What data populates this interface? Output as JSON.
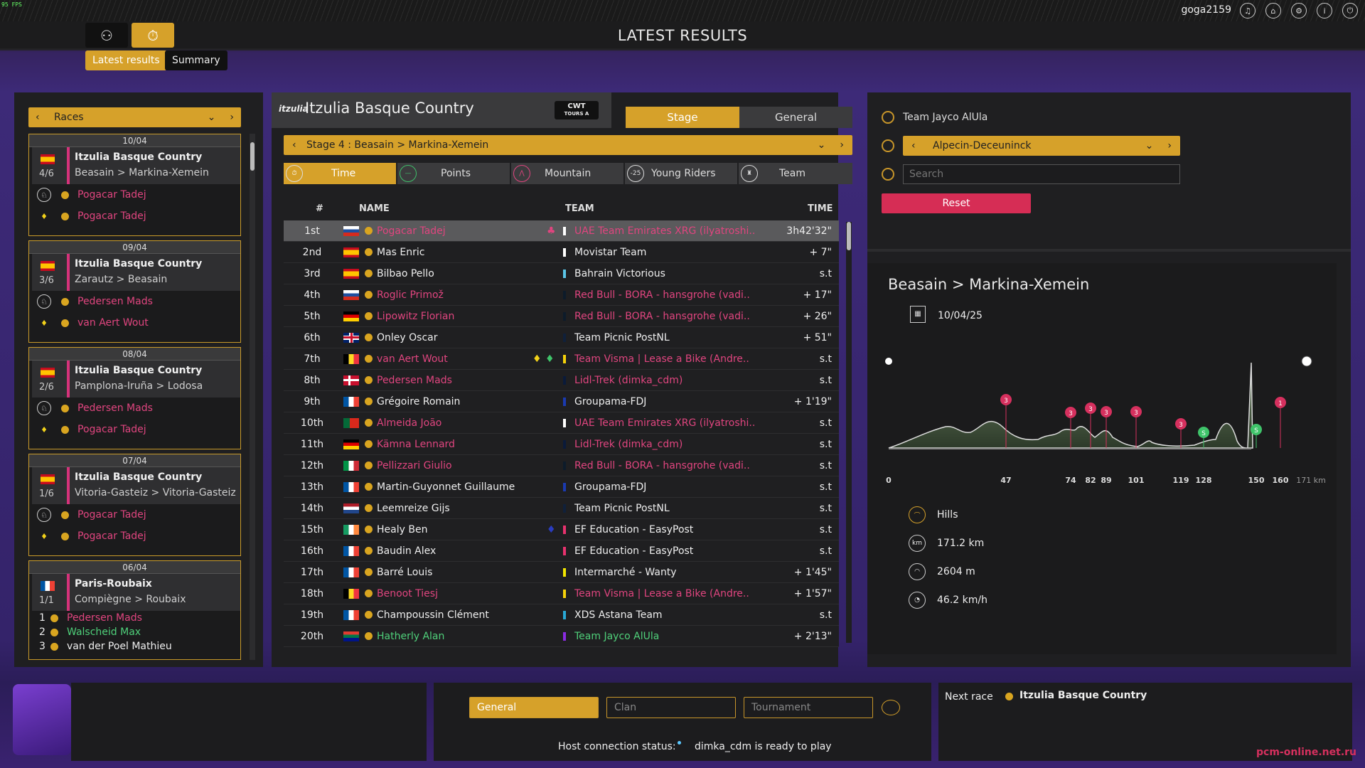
{
  "fps": "95 FPS",
  "user": "goga2159",
  "page_title": "LATEST RESULTS",
  "subtabs": [
    "Latest results",
    "Summary"
  ],
  "races_dropdown": "Races",
  "race_cards": [
    {
      "date": "10/04",
      "name": "Itzulia Basque Country",
      "stage": "4/6",
      "route": "Beasain > Markina-Xemein",
      "flag": "es",
      "lines": [
        {
          "icon": "stage-winner-icon",
          "rider": "Pogacar Tadej"
        },
        {
          "icon": "yellow-jersey-icon",
          "rider": "Pogacar Tadej"
        }
      ]
    },
    {
      "date": "09/04",
      "name": "Itzulia Basque Country",
      "stage": "3/6",
      "route": "Zarautz > Beasain",
      "flag": "es",
      "lines": [
        {
          "icon": "stage-winner-icon",
          "rider": "Pedersen Mads"
        },
        {
          "icon": "yellow-jersey-icon",
          "rider": "van Aert Wout"
        }
      ]
    },
    {
      "date": "08/04",
      "name": "Itzulia Basque Country",
      "stage": "2/6",
      "route": "Pamplona-Iruña > Lodosa",
      "flag": "es",
      "lines": [
        {
          "icon": "stage-winner-icon",
          "rider": "Pedersen Mads"
        },
        {
          "icon": "yellow-jersey-icon",
          "rider": "Pogacar Tadej"
        }
      ]
    },
    {
      "date": "07/04",
      "name": "Itzulia Basque Country",
      "stage": "1/6",
      "route": "Vitoria-Gasteiz > Vitoria-Gasteiz",
      "flag": "es",
      "lines": [
        {
          "icon": "stage-winner-icon",
          "rider": "Pogacar Tadej"
        },
        {
          "icon": "yellow-jersey-icon",
          "rider": "Pogacar Tadej"
        }
      ]
    },
    {
      "date": "06/04",
      "name": "Paris-Roubaix",
      "stage": "1/1",
      "route": "Compiègne > Roubaix",
      "flag": "fr",
      "podium": [
        {
          "pos": "1",
          "rider": "Pedersen Mads",
          "color": "pink"
        },
        {
          "pos": "2",
          "rider": "Walscheid Max",
          "color": "green"
        },
        {
          "pos": "3",
          "rider": "van der Poel Mathieu",
          "color": "white"
        }
      ]
    }
  ],
  "race": {
    "name": "Itzulia Basque Country",
    "logo_text": "itzulia",
    "badge_line1": "CWT",
    "badge_line2": "TOURS A"
  },
  "view_tabs": [
    "Stage",
    "General"
  ],
  "stage_select": "Stage 4 : Beasain > Markina-Xemein",
  "classification_tabs": [
    "Time",
    "Points",
    "Mountain",
    "Young Riders",
    "Team"
  ],
  "young_riders_badge": "-25",
  "table_headers": {
    "pos": "#",
    "name": "NAME",
    "team": "TEAM",
    "time": "TIME"
  },
  "results": [
    {
      "pos": "1st",
      "flag": "si",
      "name": "Pogacar Tadej",
      "name_color": "pink",
      "team": "UAE Team Emirates XRG (ilyatroshi..",
      "team_color": "pink",
      "team_mark": "#ffffff",
      "time": "3h42'32\""
    },
    {
      "pos": "2nd",
      "flag": "es",
      "name": "Mas Enric",
      "name_color": "white",
      "team": "Movistar Team",
      "team_color": "white",
      "team_mark": "#ffffff",
      "time": "+ 7\""
    },
    {
      "pos": "3rd",
      "flag": "es",
      "name": "Bilbao Pello",
      "name_color": "white",
      "team": "Bahrain Victorious",
      "team_color": "white",
      "team_mark": "#5bc6e8",
      "time": "s.t"
    },
    {
      "pos": "4th",
      "flag": "si",
      "name": "Roglic Primož",
      "name_color": "pink",
      "team": "Red Bull - BORA - hansgrohe (vadi..",
      "team_color": "pink",
      "team_mark": "#0d1b2a",
      "time": "+ 17\""
    },
    {
      "pos": "5th",
      "flag": "de",
      "name": "Lipowitz Florian",
      "name_color": "pink",
      "team": "Red Bull - BORA - hansgrohe (vadi..",
      "team_color": "pink",
      "team_mark": "#0d1b2a",
      "time": "+ 26\""
    },
    {
      "pos": "6th",
      "flag": "gb",
      "name": "Onley Oscar",
      "name_color": "white",
      "team": "Team Picnic PostNL",
      "team_color": "white",
      "team_mark": "#10203a",
      "time": "+ 51\""
    },
    {
      "pos": "7th",
      "flag": "be",
      "name": "van Aert Wout",
      "name_color": "pink",
      "team": "Team Visma | Lease a Bike (Andre..",
      "team_color": "pink",
      "team_mark": "#f5d20a",
      "time": "s.t"
    },
    {
      "pos": "8th",
      "flag": "dk",
      "name": "Pedersen Mads",
      "name_color": "pink",
      "team": "Lidl-Trek (dimka_cdm)",
      "team_color": "pink",
      "team_mark": "#0a1a3a",
      "time": "s.t"
    },
    {
      "pos": "9th",
      "flag": "fr",
      "name": "Grégoire Romain",
      "name_color": "white",
      "team": "Groupama-FDJ",
      "team_color": "white",
      "team_mark": "#1a3ab0",
      "time": "+ 1'19\""
    },
    {
      "pos": "10th",
      "flag": "pt",
      "name": "Almeida João",
      "name_color": "pink",
      "team": "UAE Team Emirates XRG (ilyatroshi..",
      "team_color": "pink",
      "team_mark": "#ffffff",
      "time": "s.t"
    },
    {
      "pos": "11th",
      "flag": "de",
      "name": "Kämna Lennard",
      "name_color": "pink",
      "team": "Lidl-Trek (dimka_cdm)",
      "team_color": "pink",
      "team_mark": "#0a1a3a",
      "time": "s.t"
    },
    {
      "pos": "12th",
      "flag": "it",
      "name": "Pellizzari Giulio",
      "name_color": "pink",
      "team": "Red Bull - BORA - hansgrohe (vadi..",
      "team_color": "pink",
      "team_mark": "#0d1b2a",
      "time": "s.t"
    },
    {
      "pos": "13th",
      "flag": "fr",
      "name": "Martin-Guyonnet Guillaume",
      "name_color": "white",
      "team": "Groupama-FDJ",
      "team_color": "white",
      "team_mark": "#1a3ab0",
      "time": "s.t"
    },
    {
      "pos": "14th",
      "flag": "nl",
      "name": "Leemreize Gijs",
      "name_color": "white",
      "team": "Team Picnic PostNL",
      "team_color": "white",
      "team_mark": "#10203a",
      "time": "s.t"
    },
    {
      "pos": "15th",
      "flag": "ie",
      "name": "Healy Ben",
      "name_color": "white",
      "team": "EF Education - EasyPost",
      "team_color": "white",
      "team_mark": "#e8326e",
      "time": "s.t"
    },
    {
      "pos": "16th",
      "flag": "fr",
      "name": "Baudin Alex",
      "name_color": "white",
      "team": "EF Education - EasyPost",
      "team_color": "white",
      "team_mark": "#e8326e",
      "time": "s.t"
    },
    {
      "pos": "17th",
      "flag": "fr",
      "name": "Barré Louis",
      "name_color": "white",
      "team": "Intermarché - Wanty",
      "team_color": "white",
      "team_mark": "#f2e600",
      "time": "+ 1'45\""
    },
    {
      "pos": "18th",
      "flag": "be",
      "name": "Benoot Tiesj",
      "name_color": "pink",
      "team": "Team Visma | Lease a Bike (Andre..",
      "team_color": "pink",
      "team_mark": "#f5d20a",
      "time": "+ 1'57\""
    },
    {
      "pos": "19th",
      "flag": "fr",
      "name": "Champoussin Clément",
      "name_color": "white",
      "team": "XDS Astana Team",
      "team_color": "white",
      "team_mark": "#29a9d6",
      "time": "s.t"
    },
    {
      "pos": "20th",
      "flag": "za",
      "name": "Hatherly Alan",
      "name_color": "green",
      "team": "Team Jayco AlUla",
      "team_color": "green",
      "team_mark": "#8a2be2",
      "time": "+ 2'13\""
    }
  ],
  "filters": {
    "team_label": "Team Jayco AlUla",
    "team_dropdown": "Alpecin-Deceuninck",
    "search_placeholder": "Search",
    "reset": "Reset"
  },
  "stage_info": {
    "title": "Beasain > Markina-Xemein",
    "date": "10/04/25",
    "km_ticks": [
      "0",
      "47",
      "74",
      "82",
      "89",
      "101",
      "119",
      "128",
      "150",
      "160",
      "171 km"
    ],
    "climb_labels": [
      "3",
      "3",
      "3",
      "3",
      "3",
      "3",
      "1"
    ],
    "sprint_labels": [
      "S",
      "S"
    ],
    "stats": [
      {
        "icon": "hills-icon",
        "value": "Hills"
      },
      {
        "icon": "distance-icon",
        "value": "171.2 km"
      },
      {
        "icon": "elevation-icon",
        "value": "2604 m"
      },
      {
        "icon": "speed-icon",
        "value": "46.2 km/h"
      }
    ]
  },
  "chat": {
    "tabs": [
      "General",
      "Clan",
      "Tournament"
    ],
    "status_label": "Host connection status:",
    "status_value": "dimka_cdm is ready to play"
  },
  "next_race": {
    "label": "Next race",
    "race": "Itzulia Basque Country"
  },
  "watermark": "pcm-online.net.ru",
  "colors": {
    "accent": "#d6a12a",
    "pink": "#e0457f",
    "green": "#4fd07a",
    "reset": "#d62d55"
  }
}
